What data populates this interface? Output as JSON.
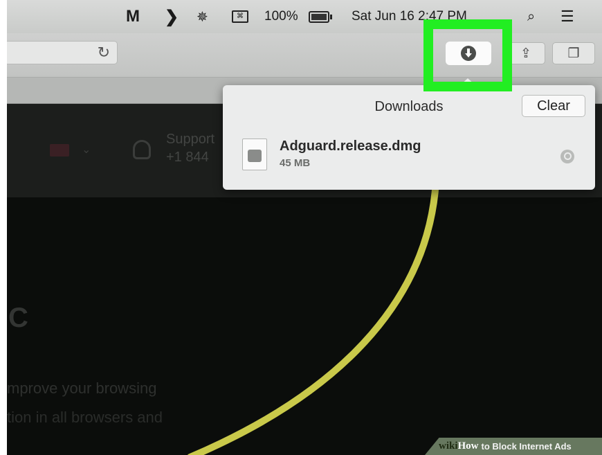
{
  "menubar": {
    "battery_percent": "100%",
    "clock": "Sat Jun 16  2:47 PM",
    "icons": [
      "malwarebytes-icon",
      "chevron-right-icon",
      "bluetooth-icon",
      "keyboard-icon",
      "battery-icon",
      "search-icon",
      "list-icon"
    ]
  },
  "toolbar": {
    "icons": [
      "reload-icon",
      "downloads-icon",
      "share-icon",
      "tabs-icon"
    ]
  },
  "page": {
    "support_label": "Support",
    "support_phone": "+1 844",
    "hero_letter": "C",
    "hero_line1": "mprove your browsing",
    "hero_line2": "tion in all browsers and"
  },
  "downloads": {
    "title": "Downloads",
    "clear_label": "Clear",
    "items": [
      {
        "name": "Adguard.release.dmg",
        "size": "45 MB"
      }
    ]
  },
  "watermark": {
    "brand": "wiki",
    "how": "How",
    "text": "to Block Internet Ads"
  },
  "colors": {
    "highlight": "#22ee22",
    "arc": "#c9c94a"
  }
}
